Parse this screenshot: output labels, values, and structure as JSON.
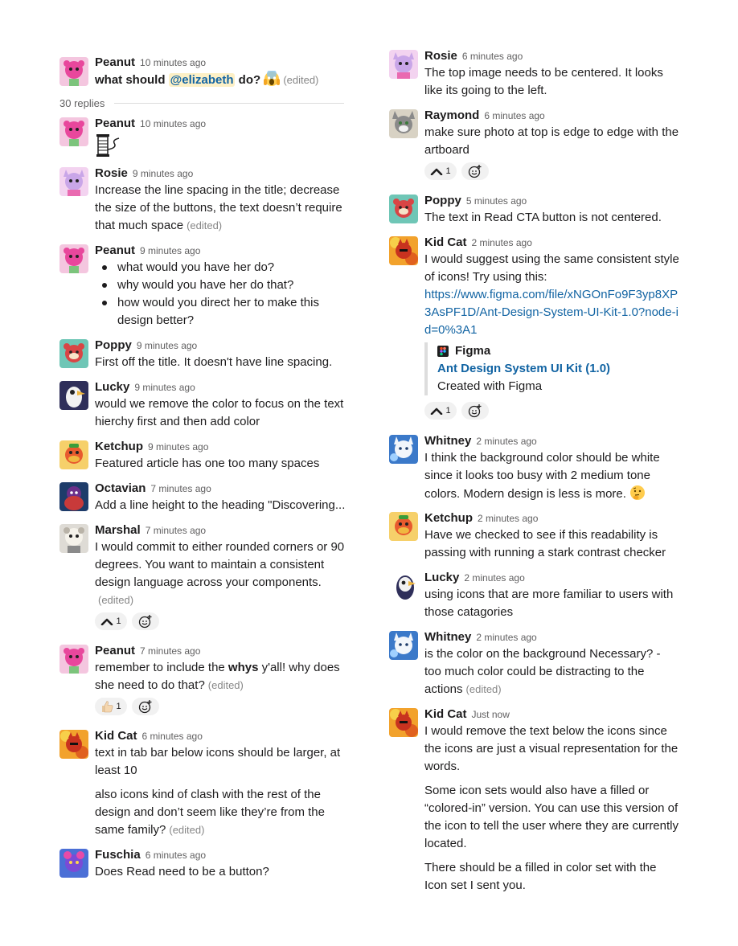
{
  "root": {
    "name": "Peanut",
    "time": "10 minutes ago",
    "text_before": "what should ",
    "mention": "@elizabeth",
    "text_after": " do?",
    "emoji": "scream-emoji",
    "edited": "(edited)"
  },
  "replies_label": "30 replies",
  "left": {
    "m1": {
      "name": "Peanut",
      "time": "10 minutes ago",
      "emoji": "thread-spool-emoji"
    },
    "m2": {
      "name": "Rosie",
      "time": "9 minutes ago",
      "text": "Increase the line spacing in the title; decrease the size of the buttons, the text doesn’t require that much space",
      "edited": "(edited)"
    },
    "m3": {
      "name": "Peanut",
      "time": "9 minutes ago",
      "bullets": [
        "what would you have her do?",
        "why would you have her do that?",
        "how would you direct her to make this design better?"
      ]
    },
    "m4": {
      "name": "Poppy",
      "time": "9 minutes ago",
      "text": "First off the title. It doesn't have line spacing."
    },
    "m5": {
      "name": "Lucky",
      "time": "9 minutes ago",
      "text": "would we remove the color to focus on the text hierchy first and then add color"
    },
    "m6": {
      "name": "Ketchup",
      "time": "9 minutes ago",
      "text": "Featured article has one too many spaces"
    },
    "m7": {
      "name": "Octavian",
      "time": "7 minutes ago",
      "text": "Add a line height to the heading \"Discovering..."
    },
    "m8": {
      "name": "Marshal",
      "time": "7 minutes ago",
      "text": "I would commit to either rounded corners or 90 degrees. You want to maintain a consistent design language across your components.",
      "edited": "(edited)",
      "react_count": "1"
    },
    "m9": {
      "name": "Peanut",
      "time": "7 minutes ago",
      "text_before": "remember to include the ",
      "bold": "whys",
      "text_after": " y'all! why does she need to do that?",
      "edited": "(edited)",
      "react_count": "1"
    },
    "m10": {
      "name": "Kid Cat",
      "time": "6 minutes ago",
      "p1": "text in tab bar below icons should be larger, at least 10",
      "p2": "also icons kind of clash with the rest of the design and don’t seem like they’re from the same family?",
      "edited": "(edited)"
    },
    "m11": {
      "name": "Fuschia",
      "time": "6 minutes ago",
      "text": "Does Read need to be a button?"
    }
  },
  "right": {
    "m1": {
      "name": "Rosie",
      "time": "6 minutes ago",
      "text": "The top image needs to be  centered. It looks like its going to the left."
    },
    "m2": {
      "name": "Raymond",
      "time": "6 minutes ago",
      "text": "make sure photo at top is edge to edge with the artboard",
      "react_count": "1"
    },
    "m3": {
      "name": "Poppy",
      "time": "5 minutes ago",
      "text": "The text in Read CTA button is not centered."
    },
    "m4": {
      "name": "Kid Cat",
      "time": "2 minutes ago",
      "text": "I would suggest using the same consistent style of icons! Try using this:",
      "link": "https://www.figma.com/file/xNGOnFo9F3yp8XP3AsPF1D/Ant-Design-System-UI-Kit-1.0?node-id=0%3A1",
      "unfurl_service": "Figma",
      "unfurl_title": "Ant Design System UI Kit (1.0)",
      "unfurl_desc": "Created with Figma",
      "react_count": "1"
    },
    "m5": {
      "name": "Whitney",
      "time": "2 minutes ago",
      "text": "I think the background color should be white since it looks too busy with 2 medium tone colors. Modern design is less is more.",
      "emoji": "thinking-face-emoji"
    },
    "m6": {
      "name": "Ketchup",
      "time": "2 minutes ago",
      "text": "Have we checked to see if this readability is passing with running a stark contrast checker"
    },
    "m7": {
      "name": "Lucky",
      "time": "2 minutes ago",
      "text": "using icons that are more familiar to users with those catagories"
    },
    "m8": {
      "name": "Whitney",
      "time": "2 minutes ago",
      "text": "is the color on the background Necessary? - too much color could be distracting to the actions",
      "edited": "(edited)"
    },
    "m9": {
      "name": "Kid Cat",
      "time": "Just now",
      "p1": "I would remove the text below the icons since the icons are just a visual representation for the words.",
      "p2": "Some icon sets would also have a filled or “colored-in” version. You can use this version of the icon to tell the user where they are currently located.",
      "p3": "There should be a filled in color set with the Icon set I sent you."
    }
  },
  "reaction_icons": {
    "caret": "caret-up-icon",
    "thumbs": "thumbs-up-emoji",
    "add": "add-reaction-icon"
  },
  "colors": {
    "Peanut": "#e8479c",
    "Rosie": "#c9a6e8",
    "Poppy": "#d94545",
    "Lucky": "#2f2f5a",
    "Ketchup": "#f0b840",
    "Octavian": "#6b2f8a",
    "Marshal": "#b9b3a8",
    "Kid Cat": "#f2a22c",
    "Fuschia": "#7a4bd6",
    "Raymond": "#8a8a8a",
    "Whitney": "#3b79c9",
    "link": "#1264a3"
  }
}
